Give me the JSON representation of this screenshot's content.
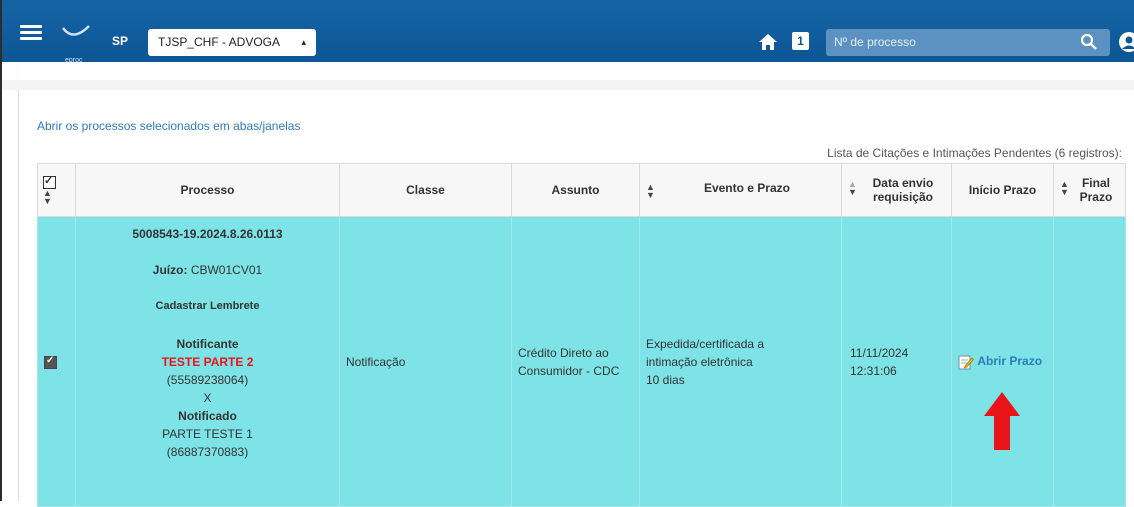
{
  "header": {
    "logo_text": "eproc",
    "state": "SP",
    "profile_select": "TJSP_CHF - ADVOGA",
    "badge_count": "1",
    "search_placeholder": "Nº de processo"
  },
  "main": {
    "open_selected_link": "Abrir os processos selecionados em abas/janelas",
    "list_caption": "Lista de Citações e Intimações Pendentes (6 registros):"
  },
  "table": {
    "headers": {
      "processo": "Processo",
      "classe": "Classe",
      "assunto": "Assunto",
      "evento": "Evento e Prazo",
      "data_envio_1": "Data envio",
      "data_envio_2": "requisição",
      "inicio_prazo": "Início Prazo",
      "final_prazo_1": "Final",
      "final_prazo_2": "Prazo"
    },
    "rows": [
      {
        "numero": "5008543-19.2024.8.26.0113",
        "juizo_label": "Juízo:",
        "juizo_value": "CBW01CV01",
        "cadastrar": "Cadastrar Lembrete",
        "notificante_label": "Notificante",
        "notificante_nome": "TESTE PARTE 2",
        "notificante_doc": "(55589238064)",
        "x": "X",
        "notificado_label": "Notificado",
        "notificado_nome": "PARTE TESTE 1",
        "notificado_doc": "(86887370883)",
        "classe": "Notificação",
        "assunto_1": "Crédito Direto ao",
        "assunto_2": "Consumidor - CDC",
        "evento_1": "Expedida/certificada a",
        "evento_2": "intimação eletrônica",
        "evento_3": "10 dias",
        "data_1": "11/11/2024",
        "data_2": "12:31:06",
        "abrir_prazo": "Abrir Prazo"
      }
    ]
  },
  "colors": {
    "topbar": "#0d5594",
    "row_highlight": "#7de3e6",
    "link": "#2e7bb8",
    "party_red": "#e8141a",
    "annotation_arrow": "#e8141a"
  }
}
